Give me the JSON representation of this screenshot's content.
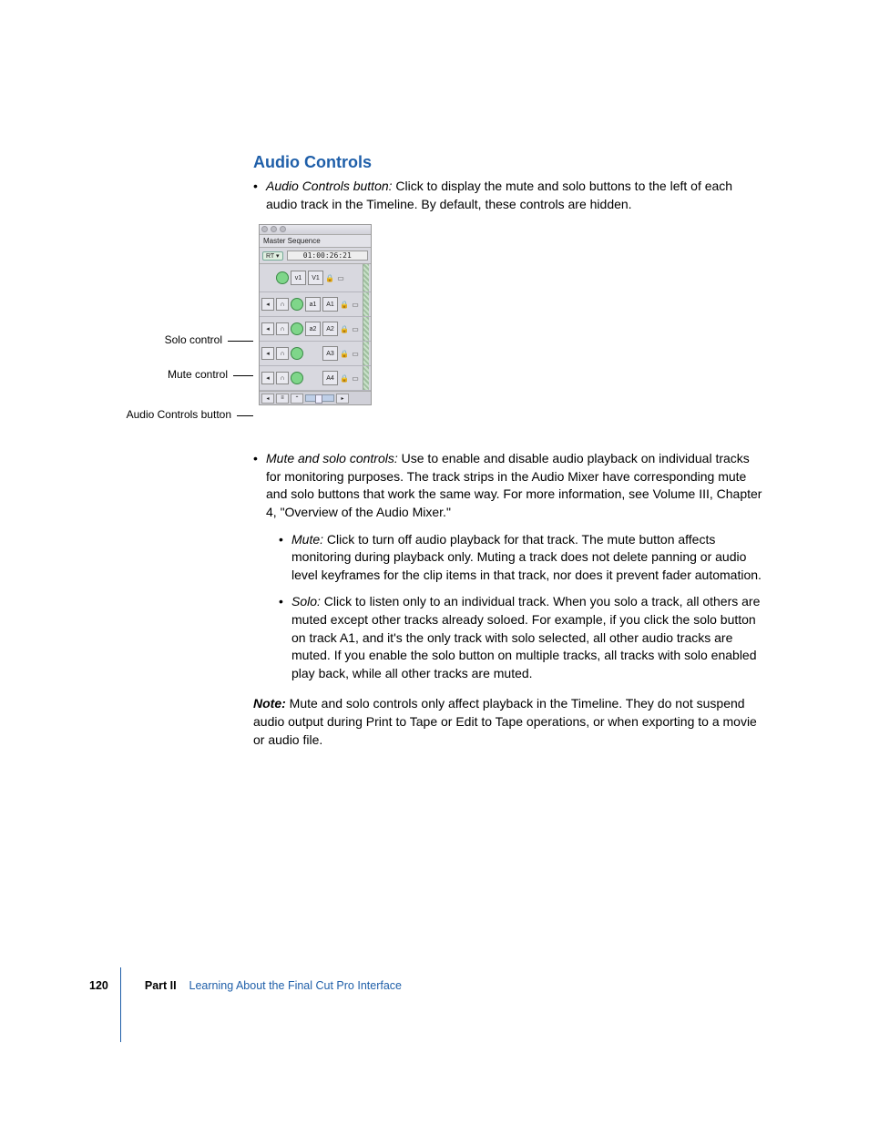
{
  "heading": "Audio Controls",
  "bullets": {
    "b1_term": "Audio Controls button:",
    "b1_text": "  Click to display the mute and solo buttons to the left of each audio track in the Timeline. By default, these controls are hidden.",
    "b2_term": "Mute and solo controls:",
    "b2_text": "  Use to enable and disable audio playback on individual tracks for monitoring purposes. The track strips in the Audio Mixer have corresponding mute and solo buttons that work the same way. For more information, see Volume III, Chapter 4, \"Overview of the Audio Mixer.\"",
    "b2a_term": "Mute:",
    "b2a_text": "  Click to turn off audio playback for that track. The mute button affects monitoring during playback only. Muting a track does not delete panning or audio level keyframes for the clip items in that track, nor does it prevent fader automation.",
    "b2b_term": "Solo:",
    "b2b_text": "  Click to listen only to an individual track. When you solo a track, all others are muted except other tracks already soloed. For example, if you click the solo button on track A1, and it's the only track with solo selected, all other audio tracks are muted. If you enable the solo button on multiple tracks, all tracks with solo enabled play back, while all other tracks are muted."
  },
  "note_label": "Note:",
  "note_text": "  Mute and solo controls only affect playback in the Timeline. They do not suspend audio output during Print to Tape or Edit to Tape operations, or when exporting to a movie or audio file.",
  "callouts": {
    "solo": "Solo control",
    "mute": "Mute control",
    "button": "Audio Controls button"
  },
  "timeline": {
    "tab": "Master Sequence",
    "rt": "RT ▾",
    "timecode": "01:00:26:21",
    "tracks": {
      "v1_src": "v1",
      "v1_dst": "V1",
      "a1_src": "a1",
      "a1_dst": "A1",
      "a2_src": "a2",
      "a2_dst": "A2",
      "a3_dst": "A3",
      "a4_dst": "A4"
    },
    "speaker": "◂",
    "headphone": "∩",
    "lock": "🔒",
    "vis": "▭",
    "footer_arrow": "◂",
    "footer_toggle": "⌃"
  },
  "footer": {
    "page": "120",
    "part": "Part II",
    "title": "Learning About the Final Cut Pro Interface"
  }
}
